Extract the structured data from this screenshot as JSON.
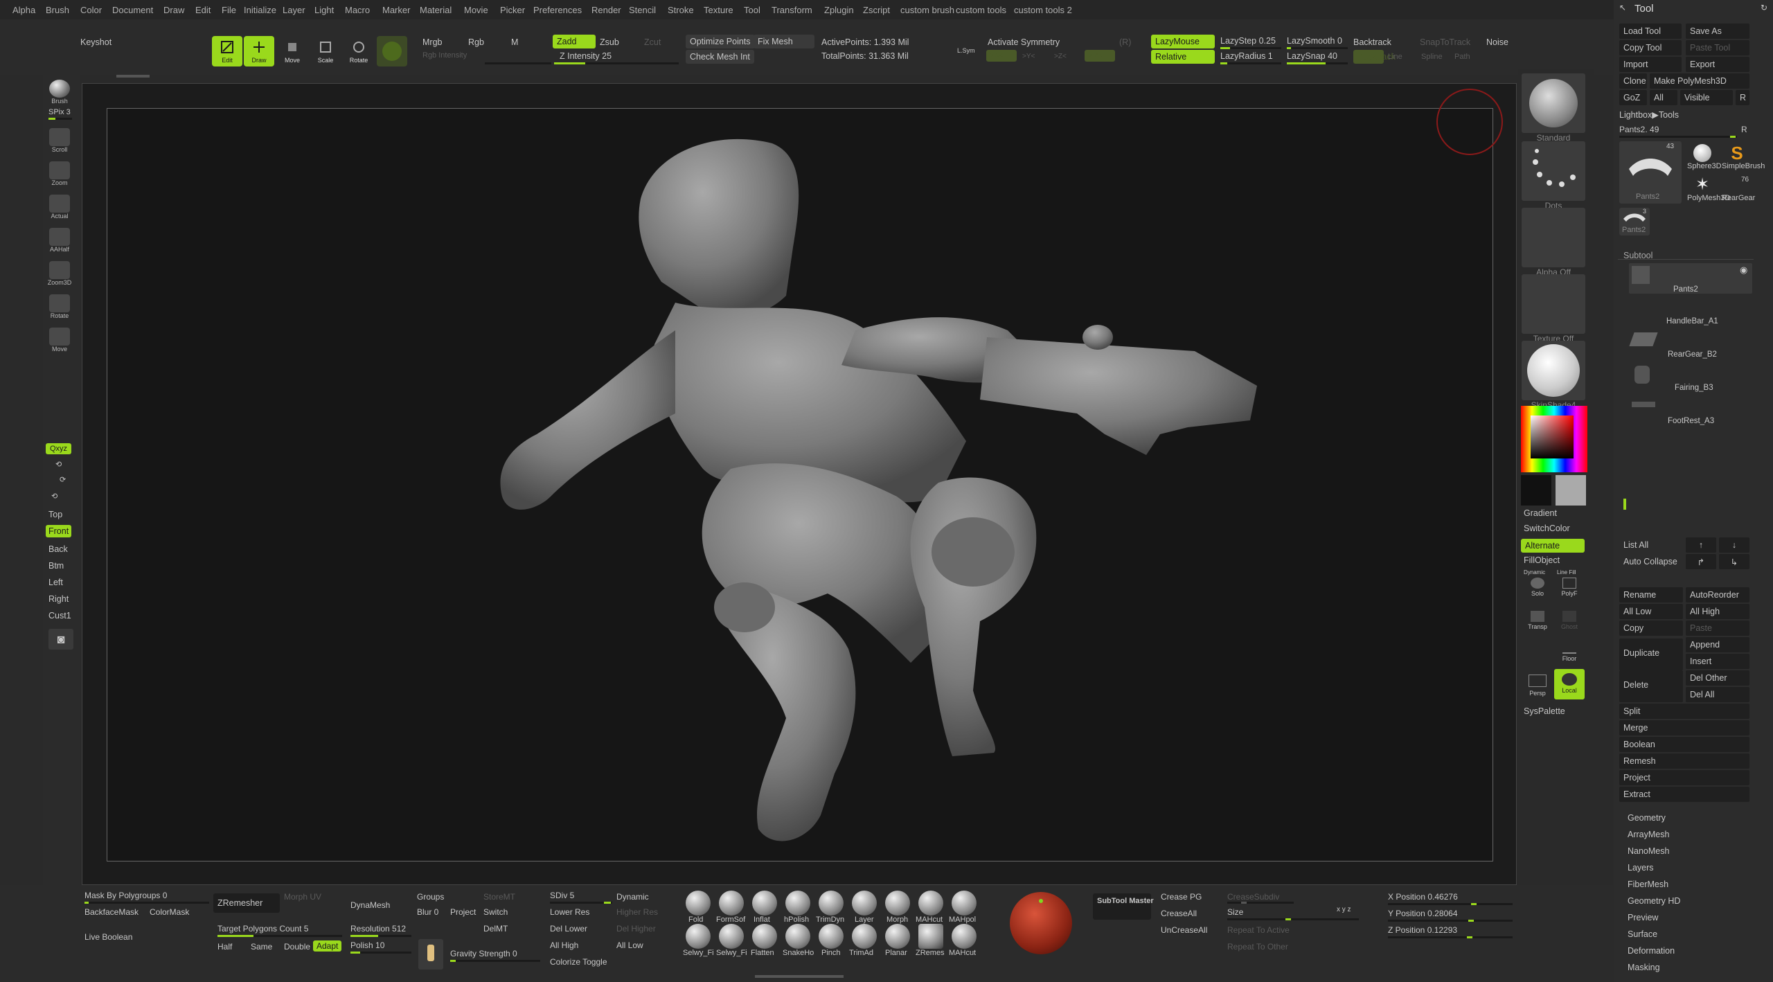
{
  "menubar": [
    "Alpha",
    "Brush",
    "Color",
    "Document",
    "Draw",
    "Edit",
    "File",
    "Initialize",
    "Layer",
    "Light",
    "Macro",
    "Marker",
    "Material",
    "Movie",
    "Picker",
    "Preferences",
    "Render",
    "Stencil",
    "Stroke",
    "Texture",
    "Tool",
    "Transform",
    "Zplugin",
    "Zscript",
    "custom brush",
    "custom tools",
    "custom tools 2"
  ],
  "topbar": {
    "keyshot": "Keyshot",
    "edit": "Edit",
    "draw": "Draw",
    "move": "Move",
    "scale": "Scale",
    "rotate": "Rotate",
    "mrgb": "Mrgb",
    "rgb": "Rgb",
    "m": "M",
    "rgb_intensity": "Rgb Intensity",
    "zadd": "Zadd",
    "zsub": "Zsub",
    "zcut": "Zcut",
    "z_intensity": "Z Intensity 25",
    "z_intensity_value": 25,
    "optimize_points": "Optimize Points",
    "fix_mesh": "Fix Mesh",
    "check_mesh": "Check Mesh Int",
    "active_points": "ActivePoints: 1.393 Mil",
    "total_points": "TotalPoints: 31.363 Mil",
    "lsym": "L.Sym",
    "activate_symmetry": "Activate Symmetry",
    "r": "(R)",
    "x": ">X<",
    "y": ">Y<",
    "z": ">Z<",
    "m_sym": ">M<",
    "lazymouse": "LazyMouse",
    "relative": "Relative",
    "lazystep": "LazyStep 0.25",
    "lazyradius": "LazyRadius 1",
    "lazysmooth": "LazySmooth 0",
    "lazysnap": "LazySnap 40",
    "backtrack": "Backtrack",
    "line": "Line",
    "spline": "Spline",
    "path": "Path",
    "snaptotrack": "SnapToTrack",
    "noise": "Noise"
  },
  "leftshelf": {
    "brush": "Brush",
    "spix": "SPix 3",
    "items": [
      "Scroll",
      "Zoom",
      "Actual",
      "AAHalf",
      "Zoom3D",
      "Rotate",
      "Move"
    ],
    "xyz": "Qxyz",
    "views": [
      "Top",
      "Front",
      "Back",
      "Btm",
      "Left",
      "Right",
      "Cust1"
    ],
    "active_view": "Front"
  },
  "rightshelf": {
    "material_standard": "Standard",
    "stroke_dots": "Dots",
    "alpha": "Alpha Off",
    "texture": "Texture Off",
    "material_skin": "SkinShade4",
    "gradient": "Gradient",
    "switchcolor": "SwitchColor",
    "alternate": "Alternate",
    "fillobject": "FillObject",
    "solo": "Solo",
    "polyf": "PolyF",
    "transp": "Transp",
    "ghost": "Ghost",
    "floor": "Floor",
    "persp": "Persp",
    "local": "Local",
    "syspalette": "SysPalette",
    "dynamic": "Dynamic",
    "linefill": "Line Fill"
  },
  "toolpanel": {
    "title": "Tool",
    "load_tool": "Load Tool",
    "save_as": "Save As",
    "copy_tool": "Copy Tool",
    "paste_tool": "Paste Tool",
    "import": "Import",
    "export": "Export",
    "clone": "Clone",
    "make_polymesh": "Make PolyMesh3D",
    "goz": "GoZ",
    "all": "All",
    "visible": "Visible",
    "r": "R",
    "lightbox_tools": "Lightbox▶Tools",
    "current_tool": "Pants2. 49",
    "thumbs": [
      {
        "label": "Pants2",
        "count": "43"
      },
      {
        "label": "Sphere3D",
        "count": ""
      },
      {
        "label": "SimpleBrush",
        "count": ""
      },
      {
        "label": "PolyMesh3D",
        "count": ""
      },
      {
        "label": "RearGear",
        "count": "76"
      },
      {
        "label": "Pants2",
        "count": "3"
      }
    ],
    "subtool_header": "Subtool",
    "subtools": [
      "Pants2",
      "HandleBar_A1",
      "RearGear_B2",
      "Fairing_B3",
      "FootRest_A3"
    ],
    "list_all": "List All",
    "auto_collapse": "Auto Collapse",
    "rename": "Rename",
    "autoreorder": "AutoReorder",
    "all_low": "All Low",
    "all_high": "All High",
    "copy": "Copy",
    "paste": "Paste",
    "duplicate": "Duplicate",
    "append": "Append",
    "insert": "Insert",
    "delete": "Delete",
    "del_other": "Del Other",
    "del_all": "Del All",
    "actions": [
      "Split",
      "Merge",
      "Boolean",
      "Remesh",
      "Project",
      "Extract"
    ],
    "sections": [
      "Geometry",
      "ArrayMesh",
      "NanoMesh",
      "Layers",
      "FiberMesh",
      "Geometry HD",
      "Preview",
      "Surface",
      "Deformation",
      "Masking"
    ]
  },
  "bottombar": {
    "mask_by_polygroups": "Mask By Polygroups 0",
    "backfacemask": "BackfaceMask",
    "colormask": "ColorMask",
    "live_boolean": "Live Boolean",
    "zremesher": "ZRemesher",
    "target_polys": "Target Polygons Count 5",
    "half": "Half",
    "same": "Same",
    "double": "Double",
    "adapt": "Adapt",
    "morph_uv": "Morph UV",
    "dynamesh": "DynaMesh",
    "resolution": "Resolution 512",
    "polish": "Polish 10",
    "groups": "Groups",
    "blur": "Blur 0",
    "project": "Project",
    "gravity": "Gravity Strength 0",
    "storemt": "StoreMT",
    "switch": "Switch",
    "delmt": "DelMT",
    "sdiv": "SDiv 5",
    "dynamic": "Dynamic",
    "lower_res": "Lower Res",
    "higher_res": "Higher Res",
    "del_lower": "Del Lower",
    "del_higher": "Del Higher",
    "all_high": "All High",
    "all_low": "All Low",
    "colorize_toggle": "Colorize Toggle",
    "brushes_row1": [
      "Fold",
      "FormSof",
      "Inflat",
      "hPolish",
      "TrimDyn",
      "Layer",
      "Morph",
      "MAHcut",
      "MAHpol"
    ],
    "brushes_row2": [
      "Selwy_Fi",
      "Selwy_Fi",
      "Flatten",
      "SnakeHo",
      "Pinch",
      "TrimAd",
      "Planar",
      "ZRemes",
      "MAHcut"
    ],
    "subtool_master": "SubTool Master",
    "crease_pg": "Crease PG",
    "creaseall": "CreaseAll",
    "uncreaseall": "UnCreaseAll",
    "crease_subdiv": "CreaseSubdiv",
    "size": "Size",
    "xyz": "x y z",
    "repeat_active": "Repeat To Active",
    "repeat_other": "Repeat To Other",
    "x_position": "X Position 0.46276",
    "y_position": "Y Position 0.28064",
    "z_position": "Z Position 0.12293"
  },
  "colors": {
    "accent": "#9ad91c",
    "bg": "#2a2a2a",
    "canvas": "#161616"
  }
}
